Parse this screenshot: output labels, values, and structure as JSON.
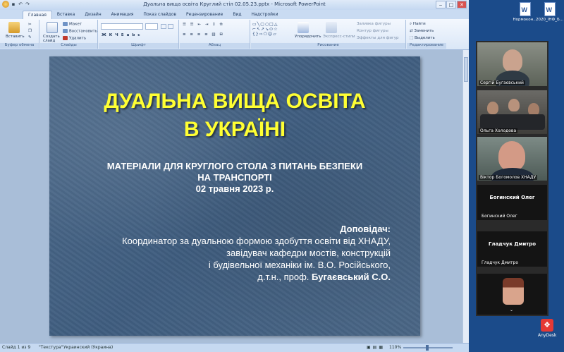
{
  "window": {
    "title": "Дуальна вища освіта Круглий стіл 02.05.23.pptx - Microsoft PowerPoint",
    "controls": [
      "‒",
      "□",
      "✕"
    ]
  },
  "tabs": [
    "Главная",
    "Вставка",
    "Дизайн",
    "Анимация",
    "Показ слайдов",
    "Рецензирование",
    "Вид",
    "Надстройки"
  ],
  "ribbon": {
    "clipboard": {
      "label": "Буфер обмена",
      "paste": "Вставить"
    },
    "slides": {
      "label": "Слайды",
      "new_slide": "Создать слайд",
      "layout": "Макет",
      "reset": "Восстановить",
      "delete": "Удалить"
    },
    "font": {
      "label": "Шрифт"
    },
    "paragraph": {
      "label": "Абзац"
    },
    "drawing": {
      "label": "Рисование",
      "arrange": "Упорядочить",
      "quick_styles": "Экспресс-стили",
      "fill": "Заливка фигуры",
      "outline": "Контур фигуры",
      "effects": "Эффекты для фигур"
    },
    "editing": {
      "label": "Редактирование",
      "find": "Найти",
      "replace": "Заменить",
      "select": "Выделить"
    }
  },
  "slide": {
    "title_line1": "ДУАЛЬНА ВИЩА ОСВІТА",
    "title_line2": "В УКРАЇНІ",
    "sub_line1": "МАТЕРІАЛИ ДЛЯ КРУГЛОГО СТОЛА З ПИТАНЬ БЕЗПЕКИ",
    "sub_line2": "НА ТРАНСПОРТІ",
    "date": "02 травня 2023 р.",
    "reporter_label": "Доповідач:",
    "rep_line1": "Координатор за дуальною формою здобуття освіти від ХНАДУ,",
    "rep_line2": "завідувач кафедри мостів, конструкцій",
    "rep_line3": "і будівельної механіки ім. В.О. Російського,",
    "rep_line4": "д.т.н., проф.",
    "rep_name": "Бугаєвський С.О."
  },
  "status": {
    "slide": "Слайд 1 из 9",
    "theme": "\"Текстура\"",
    "language": "Украинский (Украина)",
    "zoom": "110%"
  },
  "desktop": {
    "files": [
      "Нормокон...",
      "2020_ІНФ_Б..."
    ]
  },
  "participants": [
    {
      "name": "Сергій Бугаєвський"
    },
    {
      "name": "Ольга Холодова"
    },
    {
      "name": "Віктор Богомолов ХНАДУ"
    },
    {
      "name": "Богинский Олег",
      "big": "Богинский Олег"
    },
    {
      "name": "Гладчук Дмитро",
      "big": "Гладчук Дмитро"
    },
    {
      "name": ""
    }
  ],
  "anydesk": "AnyDesk"
}
